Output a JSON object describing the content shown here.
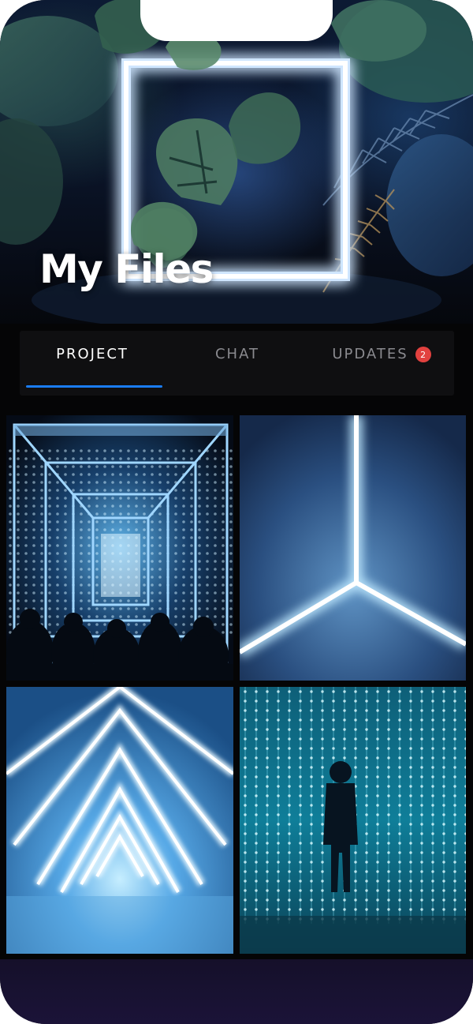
{
  "header": {
    "title": "My Files"
  },
  "tabs": [
    {
      "label": "PROJECT",
      "active": true
    },
    {
      "label": "CHAT",
      "active": false
    },
    {
      "label": "UPDATES",
      "active": false,
      "badge": "2"
    }
  ],
  "gallery": [
    {
      "name": "Light tunnel with crowd"
    },
    {
      "name": "Light beams corner"
    },
    {
      "name": "Triangle neon tunnel"
    },
    {
      "name": "Hanging lights room"
    }
  ],
  "colors": {
    "accent": "#1a7cf5",
    "badge": "#e2413f",
    "background": "#050506"
  }
}
